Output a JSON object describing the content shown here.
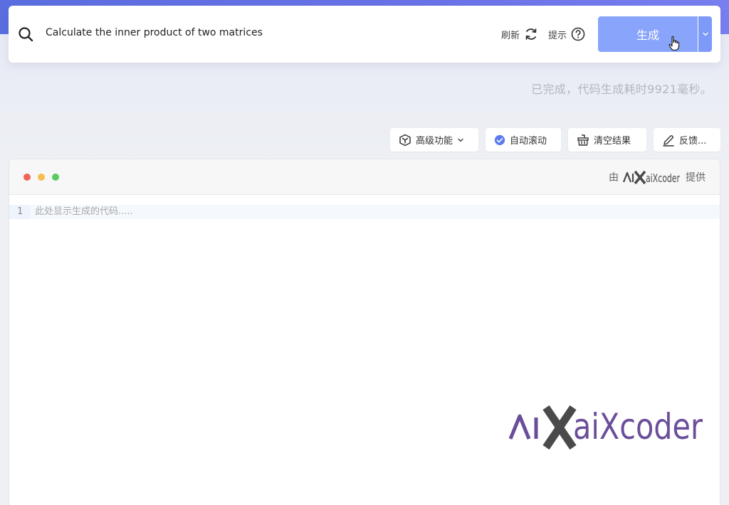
{
  "search": {
    "query": "Calculate the inner product of two matrices"
  },
  "actions": {
    "refresh_label": "刷新",
    "hint_label": "提示",
    "generate_label": "生成"
  },
  "status": {
    "text": "已完成，代码生成耗时9921毫秒。"
  },
  "toolbar": {
    "advanced_label": "高级功能",
    "auto_scroll_label": "自动滚动",
    "auto_scroll_checked": true,
    "clear_label": "清空结果",
    "feedback_label": "反馈..."
  },
  "editor": {
    "provided_prefix": "由",
    "brand_name": "aiXcoder",
    "provided_suffix": "提供",
    "line_number": "1",
    "placeholder": "此处显示生成的代码....."
  },
  "colors": {
    "primary": "#89a4fb",
    "brand_purple": "#6b4e9a",
    "brand_gray": "#4a4a4a",
    "check_blue": "#5b7cf0"
  },
  "icons": {
    "search": "search-icon",
    "refresh": "refresh-icon",
    "help": "help-circle-icon",
    "chevron": "chevron-down-icon",
    "cube": "cube-icon",
    "check": "check-circle-icon",
    "basket": "basket-icon",
    "pen": "pen-icon",
    "cursor": "hand-cursor-icon"
  }
}
